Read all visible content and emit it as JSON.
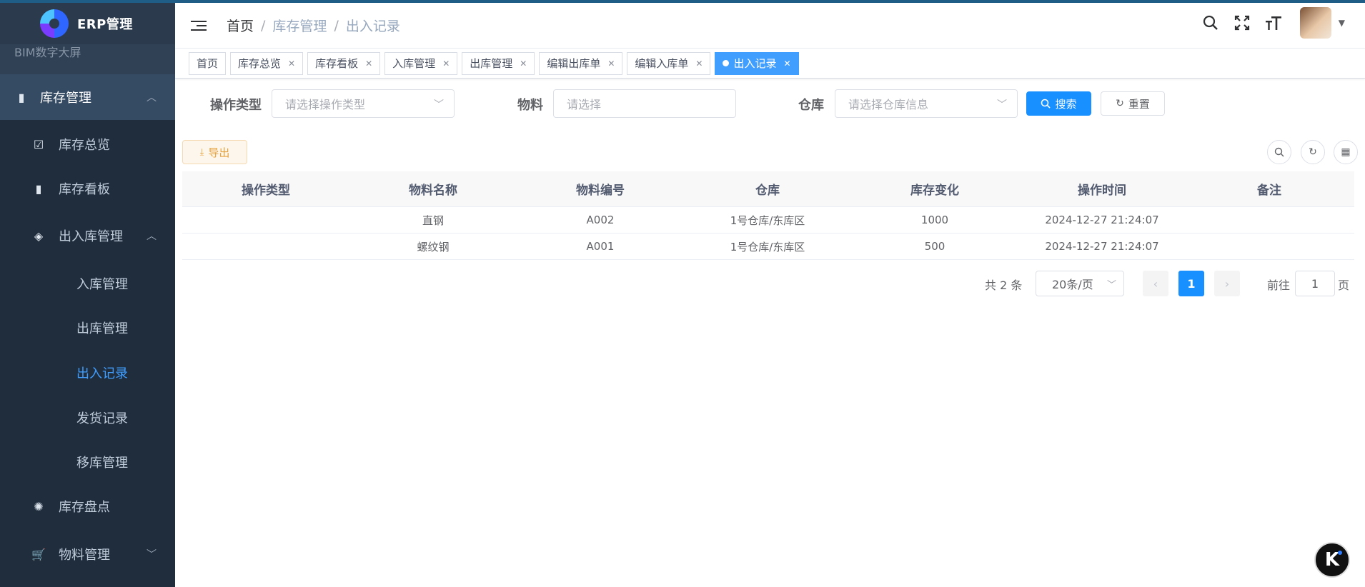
{
  "app": {
    "title": "ERP管理"
  },
  "sidebar": {
    "clipped_item": "BIM数字大屏",
    "items": [
      {
        "label": "库存管理",
        "icon": "bar-chart-icon",
        "expanded": true
      },
      {
        "label": "库存总览",
        "icon": "monitor-icon"
      },
      {
        "label": "库存看板",
        "icon": "bar-chart-icon"
      },
      {
        "label": "出入库管理",
        "icon": "layers-icon",
        "expanded": true
      },
      {
        "label": "入库管理"
      },
      {
        "label": "出库管理"
      },
      {
        "label": "出入记录",
        "active": true
      },
      {
        "label": "发货记录"
      },
      {
        "label": "移库管理"
      },
      {
        "label": "库存盘点",
        "icon": "aperture-icon"
      },
      {
        "label": "物料管理",
        "icon": "cart-icon",
        "expanded": false
      }
    ]
  },
  "header": {
    "breadcrumb": [
      "首页",
      "库存管理",
      "出入记录"
    ],
    "separator": "/"
  },
  "tags": [
    {
      "label": "首页",
      "closable": false
    },
    {
      "label": "库存总览",
      "closable": true
    },
    {
      "label": "库存看板",
      "closable": true
    },
    {
      "label": "入库管理",
      "closable": true
    },
    {
      "label": "出库管理",
      "closable": true
    },
    {
      "label": "编辑出库单",
      "closable": true
    },
    {
      "label": "编辑入库单",
      "closable": true
    },
    {
      "label": "出入记录",
      "closable": true,
      "active": true
    }
  ],
  "search": {
    "op_type_label": "操作类型",
    "op_type_placeholder": "请选择操作类型",
    "material_label": "物料",
    "material_placeholder": "请选择",
    "warehouse_label": "仓库",
    "warehouse_placeholder": "请选择仓库信息",
    "search_btn": "搜索",
    "reset_btn": "重置"
  },
  "toolbar": {
    "export_btn": "导出"
  },
  "table": {
    "columns": [
      "操作类型",
      "物料名称",
      "物料编号",
      "仓库",
      "库存变化",
      "操作时间",
      "备注"
    ],
    "rows": [
      [
        "",
        "直钢",
        "A002",
        "1号仓库/东库区",
        "1000",
        "2024-12-27 21:24:07",
        ""
      ],
      [
        "",
        "螺纹钢",
        "A001",
        "1号仓库/东库区",
        "500",
        "2024-12-27 21:24:07",
        ""
      ]
    ]
  },
  "pagination": {
    "total": "共 2 条",
    "page_size": "20条/页",
    "current_page": "1",
    "goto_label": "前往",
    "goto_value": "1",
    "page_suffix": "页"
  },
  "colors": {
    "primary": "#1890ff",
    "sidebar_bg": "#304156",
    "submenu_bg": "#1f2d3d",
    "active_text": "#409eff",
    "warning": "#e6a23c"
  }
}
